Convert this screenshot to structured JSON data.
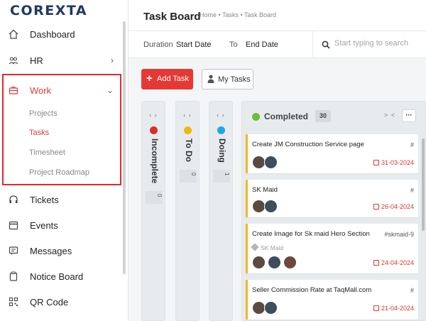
{
  "app": {
    "logo": "COREXTA"
  },
  "sidebar": {
    "items": [
      {
        "label": "Dashboard",
        "icon": "home-icon"
      },
      {
        "label": "HR",
        "icon": "people-icon"
      },
      {
        "label": "Work",
        "icon": "briefcase-icon"
      },
      {
        "label": "Tickets",
        "icon": "headset-icon"
      },
      {
        "label": "Events",
        "icon": "calendar-icon"
      },
      {
        "label": "Messages",
        "icon": "chat-icon"
      },
      {
        "label": "Notice Board",
        "icon": "clipboard-icon"
      },
      {
        "label": "QR Code",
        "icon": "qr-code-icon"
      }
    ],
    "work_subitems": [
      "Projects",
      "Tasks",
      "Timesheet",
      "Project Roadmap"
    ],
    "active_subitem": "Tasks"
  },
  "header": {
    "title": "Task Board",
    "breadcrumb": "Home • Tasks • Task Board"
  },
  "filters": {
    "duration_label": "Duration",
    "start_date": "Start Date",
    "to_label": "To",
    "end_date": "End Date",
    "search_placeholder": "Start typing to search"
  },
  "actions": {
    "add_task": "Add Task",
    "my_tasks": "My Tasks"
  },
  "board": {
    "columns": [
      {
        "name": "Incomplete",
        "count": "0",
        "color": "#d93025"
      },
      {
        "name": "To Do",
        "count": "0",
        "color": "#f2b705"
      },
      {
        "name": "Doing",
        "count": "1",
        "color": "#1aa7ec"
      }
    ],
    "completed": {
      "name": "Completed",
      "count": "30",
      "color": "#6cbf3b",
      "arrows": "> <",
      "more": "···",
      "cards": [
        {
          "title": "Create JM Construction Service page",
          "tag": "#",
          "date": "31-03-2024",
          "project": ""
        },
        {
          "title": "SK Maid",
          "tag": "#",
          "date": "26-04-2024",
          "project": ""
        },
        {
          "title": "Create Image for Sk maid Hero Section",
          "tag": "#skmaid-9",
          "date": "24-04-2024",
          "project": "SK Maid"
        },
        {
          "title": "Seller Commission Rate at TaqMall.com",
          "tag": "#",
          "date": "21-04-2024",
          "project": ""
        }
      ]
    }
  },
  "colors": {
    "accent": "#e53935",
    "card_border": "#f5b526",
    "highlight_box": "#e22a2a"
  }
}
